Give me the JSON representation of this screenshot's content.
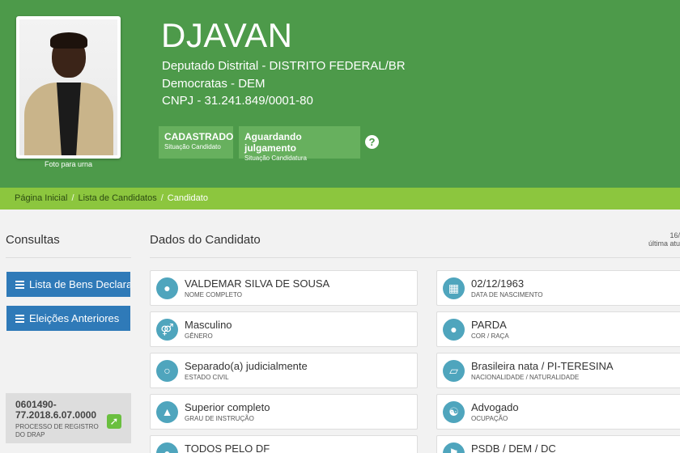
{
  "header": {
    "name": "DJAVAN",
    "role": "Deputado Distrital - DISTRITO FEDERAL/BR",
    "party": "Democratas - DEM",
    "cnpj": "CNPJ - 31.241.849/0001-80",
    "photo_caption": "Foto para urna",
    "badges": [
      {
        "title": "CADASTRADO",
        "sub": "Situação Candidato"
      },
      {
        "title": "Aguardando julgamento",
        "sub": "Situação Candidatura"
      }
    ],
    "help_glyph": "?"
  },
  "breadcrumb": {
    "items": [
      "Página Inicial",
      "Lista de Candidatos",
      "Candidato"
    ],
    "separator": "/"
  },
  "sidebar": {
    "title": "Consultas",
    "buttons": [
      "Lista de Bens Declarados",
      "Eleições Anteriores"
    ],
    "process_number": "0601490-77.2018.6.07.0000",
    "process_label": "PROCESSO DE REGISTRO DO DRAP"
  },
  "main": {
    "title": "Dados do Candidato",
    "date_partial": "16/",
    "updated_partial": "última atu",
    "cards_left": [
      {
        "value": "VALDEMAR SILVA DE SOUSA",
        "label": "NOME COMPLETO",
        "icon": "user-icon"
      },
      {
        "value": "Masculino",
        "label": "GÊNERO",
        "icon": "gender-icon"
      },
      {
        "value": "Separado(a) judicialmente",
        "label": "ESTADO CIVIL",
        "icon": "ring-icon"
      },
      {
        "value": "Superior completo",
        "label": "GRAU DE INSTRUÇÃO",
        "icon": "graduation-cap-icon"
      },
      {
        "value": "TODOS PELO DF",
        "label": "",
        "icon": "group-icon"
      }
    ],
    "cards_right": [
      {
        "value": "02/12/1963",
        "label": "DATA DE NASCIMENTO",
        "icon": "calendar-icon"
      },
      {
        "value": "PARDA",
        "label": "COR / RAÇA",
        "icon": "person-icon"
      },
      {
        "value": "Brasileira nata / PI-TERESINA",
        "label": "NACIONALIDADE / NATURALIDADE",
        "icon": "map-icon"
      },
      {
        "value": "Advogado",
        "label": "OCUPAÇÃO",
        "icon": "institution-icon"
      },
      {
        "value": "PSDB / DEM / DC",
        "label": "",
        "icon": "flag-icon"
      }
    ]
  },
  "colors": {
    "header_green": "#4d9a4a",
    "breadcrumb_green": "#8cc63e",
    "button_blue": "#2f7ab8",
    "icon_teal": "#4fa5bd"
  }
}
